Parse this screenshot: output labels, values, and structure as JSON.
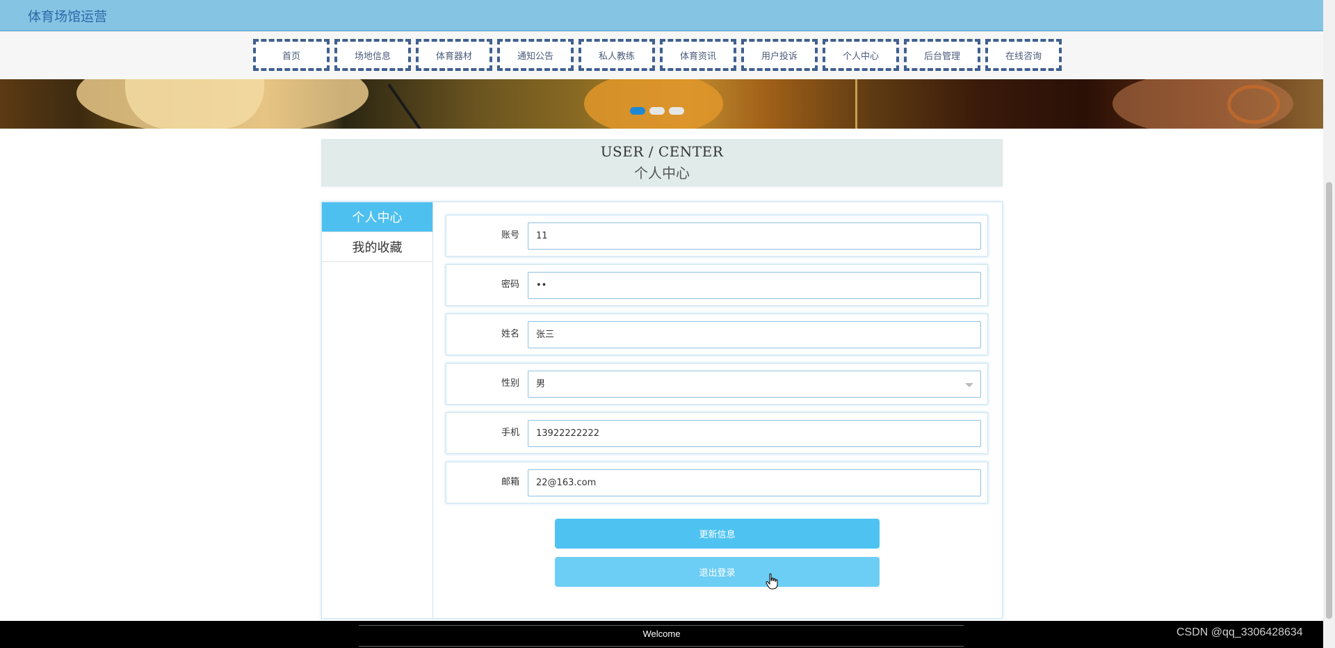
{
  "site": {
    "title": "体育场馆运营"
  },
  "nav": {
    "items": [
      "首页",
      "场地信息",
      "体育器材",
      "通知公告",
      "私人教练",
      "体育资讯",
      "用户投诉",
      "个人中心",
      "后台管理",
      "在线咨询"
    ]
  },
  "carousel": {
    "slide_count": 3,
    "active_index": 0
  },
  "section": {
    "title_en": "USER / CENTER",
    "title_cn": "个人中心"
  },
  "sidebar": {
    "items": [
      {
        "label": "个人中心",
        "active": true
      },
      {
        "label": "我的收藏",
        "active": false
      }
    ]
  },
  "form": {
    "account": {
      "label": "账号",
      "value": "11"
    },
    "password": {
      "label": "密码",
      "value": "••"
    },
    "name": {
      "label": "姓名",
      "value": "张三"
    },
    "gender": {
      "label": "性别",
      "value": "男"
    },
    "phone": {
      "label": "手机",
      "value": "13922222222"
    },
    "email": {
      "label": "邮箱",
      "value": "22@163.com"
    }
  },
  "buttons": {
    "update": "更新信息",
    "logout": "退出登录"
  },
  "footer": {
    "text": "Welcome"
  },
  "watermark": "CSDN @qq_3306428634",
  "colors": {
    "topbar": "#86c4e4",
    "accent": "#4ec3f1",
    "nav_border": "#3f5f8f",
    "dot_active": "#1e88d4"
  }
}
